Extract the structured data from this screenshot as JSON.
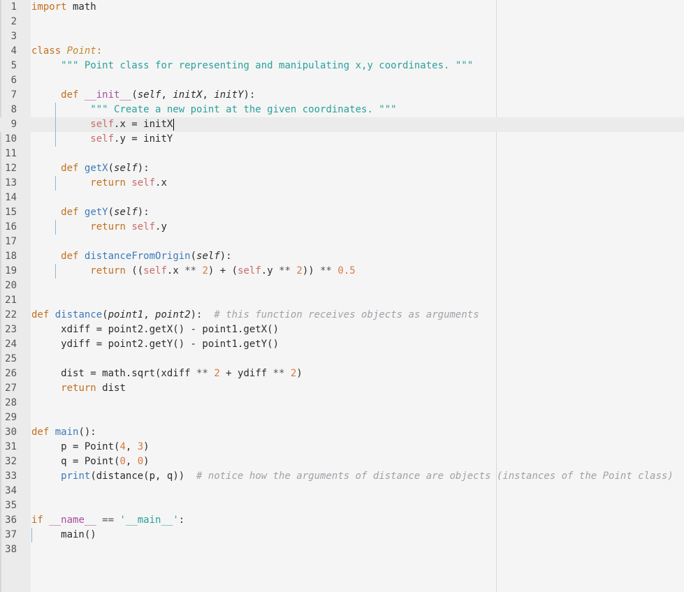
{
  "editor": {
    "language": "python",
    "current_line": 9,
    "lines": [
      {
        "n": "1",
        "t": [
          {
            "c": "kw",
            "s": "import"
          },
          {
            "c": "plain",
            "s": " math"
          }
        ]
      },
      {
        "n": "2",
        "t": []
      },
      {
        "n": "3",
        "t": []
      },
      {
        "n": "4",
        "t": [
          {
            "c": "kw",
            "s": "class"
          },
          {
            "c": "plain",
            "s": " "
          },
          {
            "c": "cls",
            "s": "Point"
          },
          {
            "c": "kw",
            "s": ":"
          }
        ]
      },
      {
        "n": "5",
        "t": [
          {
            "c": "plain",
            "s": "     "
          },
          {
            "c": "str",
            "s": "\"\"\" Point class for representing and manipulating x,y coordinates. \"\"\""
          }
        ]
      },
      {
        "n": "6",
        "t": []
      },
      {
        "n": "7",
        "t": [
          {
            "c": "plain",
            "s": "     "
          },
          {
            "c": "kw",
            "s": "def"
          },
          {
            "c": "plain",
            "s": " "
          },
          {
            "c": "under",
            "s": "__init__"
          },
          {
            "c": "plain",
            "s": "("
          },
          {
            "c": "param",
            "s": "self"
          },
          {
            "c": "plain",
            "s": ", "
          },
          {
            "c": "param",
            "s": "initX"
          },
          {
            "c": "plain",
            "s": ", "
          },
          {
            "c": "param",
            "s": "initY"
          },
          {
            "c": "plain",
            "s": "):"
          }
        ]
      },
      {
        "n": "8",
        "t": [
          {
            "c": "plain",
            "s": "          "
          },
          {
            "c": "str",
            "s": "\"\"\" Create a new point at the given coordinates. \"\"\""
          }
        ]
      },
      {
        "n": "9",
        "t": [
          {
            "c": "plain",
            "s": "          "
          },
          {
            "c": "self",
            "s": "self"
          },
          {
            "c": "plain",
            "s": ".x = initX"
          }
        ]
      },
      {
        "n": "10",
        "t": [
          {
            "c": "plain",
            "s": "          "
          },
          {
            "c": "self",
            "s": "self"
          },
          {
            "c": "plain",
            "s": ".y = initY"
          }
        ]
      },
      {
        "n": "11",
        "t": []
      },
      {
        "n": "12",
        "t": [
          {
            "c": "plain",
            "s": "     "
          },
          {
            "c": "kw",
            "s": "def"
          },
          {
            "c": "plain",
            "s": " "
          },
          {
            "c": "fn",
            "s": "getX"
          },
          {
            "c": "plain",
            "s": "("
          },
          {
            "c": "param",
            "s": "self"
          },
          {
            "c": "plain",
            "s": "):"
          }
        ]
      },
      {
        "n": "13",
        "t": [
          {
            "c": "plain",
            "s": "          "
          },
          {
            "c": "kw",
            "s": "return"
          },
          {
            "c": "plain",
            "s": " "
          },
          {
            "c": "self",
            "s": "self"
          },
          {
            "c": "plain",
            "s": ".x"
          }
        ]
      },
      {
        "n": "14",
        "t": []
      },
      {
        "n": "15",
        "t": [
          {
            "c": "plain",
            "s": "     "
          },
          {
            "c": "kw",
            "s": "def"
          },
          {
            "c": "plain",
            "s": " "
          },
          {
            "c": "fn",
            "s": "getY"
          },
          {
            "c": "plain",
            "s": "("
          },
          {
            "c": "param",
            "s": "self"
          },
          {
            "c": "plain",
            "s": "):"
          }
        ]
      },
      {
        "n": "16",
        "t": [
          {
            "c": "plain",
            "s": "          "
          },
          {
            "c": "kw",
            "s": "return"
          },
          {
            "c": "plain",
            "s": " "
          },
          {
            "c": "self",
            "s": "self"
          },
          {
            "c": "plain",
            "s": ".y"
          }
        ]
      },
      {
        "n": "17",
        "t": []
      },
      {
        "n": "18",
        "t": [
          {
            "c": "plain",
            "s": "     "
          },
          {
            "c": "kw",
            "s": "def"
          },
          {
            "c": "plain",
            "s": " "
          },
          {
            "c": "fn",
            "s": "distanceFromOrigin"
          },
          {
            "c": "plain",
            "s": "("
          },
          {
            "c": "param",
            "s": "self"
          },
          {
            "c": "plain",
            "s": "):"
          }
        ]
      },
      {
        "n": "19",
        "t": [
          {
            "c": "plain",
            "s": "          "
          },
          {
            "c": "kw",
            "s": "return"
          },
          {
            "c": "plain",
            "s": " (("
          },
          {
            "c": "self",
            "s": "self"
          },
          {
            "c": "plain",
            "s": ".x "
          },
          {
            "c": "op",
            "s": "**"
          },
          {
            "c": "plain",
            "s": " "
          },
          {
            "c": "num",
            "s": "2"
          },
          {
            "c": "plain",
            "s": ") + ("
          },
          {
            "c": "self",
            "s": "self"
          },
          {
            "c": "plain",
            "s": ".y "
          },
          {
            "c": "op",
            "s": "**"
          },
          {
            "c": "plain",
            "s": " "
          },
          {
            "c": "num",
            "s": "2"
          },
          {
            "c": "plain",
            "s": ")) "
          },
          {
            "c": "op",
            "s": "**"
          },
          {
            "c": "plain",
            "s": " "
          },
          {
            "c": "num",
            "s": "0.5"
          }
        ]
      },
      {
        "n": "20",
        "t": []
      },
      {
        "n": "21",
        "t": []
      },
      {
        "n": "22",
        "t": [
          {
            "c": "kw",
            "s": "def"
          },
          {
            "c": "plain",
            "s": " "
          },
          {
            "c": "fn",
            "s": "distance"
          },
          {
            "c": "plain",
            "s": "("
          },
          {
            "c": "param",
            "s": "point1"
          },
          {
            "c": "plain",
            "s": ", "
          },
          {
            "c": "param",
            "s": "point2"
          },
          {
            "c": "plain",
            "s": "):  "
          },
          {
            "c": "cmt",
            "s": "# this function receives objects as arguments"
          }
        ]
      },
      {
        "n": "23",
        "t": [
          {
            "c": "plain",
            "s": "     xdiff = point2.getX() - point1.getX()"
          }
        ]
      },
      {
        "n": "24",
        "t": [
          {
            "c": "plain",
            "s": "     ydiff = point2.getY() - point1.getY()"
          }
        ]
      },
      {
        "n": "25",
        "t": []
      },
      {
        "n": "26",
        "t": [
          {
            "c": "plain",
            "s": "     dist = math.sqrt(xdiff "
          },
          {
            "c": "op",
            "s": "**"
          },
          {
            "c": "plain",
            "s": " "
          },
          {
            "c": "num",
            "s": "2"
          },
          {
            "c": "plain",
            "s": " + ydiff "
          },
          {
            "c": "op",
            "s": "**"
          },
          {
            "c": "plain",
            "s": " "
          },
          {
            "c": "num",
            "s": "2"
          },
          {
            "c": "plain",
            "s": ")"
          }
        ]
      },
      {
        "n": "27",
        "t": [
          {
            "c": "plain",
            "s": "     "
          },
          {
            "c": "kw",
            "s": "return"
          },
          {
            "c": "plain",
            "s": " dist"
          }
        ]
      },
      {
        "n": "28",
        "t": []
      },
      {
        "n": "29",
        "t": []
      },
      {
        "n": "30",
        "t": [
          {
            "c": "kw",
            "s": "def"
          },
          {
            "c": "plain",
            "s": " "
          },
          {
            "c": "fn",
            "s": "main"
          },
          {
            "c": "plain",
            "s": "():"
          }
        ]
      },
      {
        "n": "31",
        "t": [
          {
            "c": "plain",
            "s": "     p = Point("
          },
          {
            "c": "num",
            "s": "4"
          },
          {
            "c": "plain",
            "s": ", "
          },
          {
            "c": "num",
            "s": "3"
          },
          {
            "c": "plain",
            "s": ")"
          }
        ]
      },
      {
        "n": "32",
        "t": [
          {
            "c": "plain",
            "s": "     q = Point("
          },
          {
            "c": "num",
            "s": "0"
          },
          {
            "c": "plain",
            "s": ", "
          },
          {
            "c": "num",
            "s": "0"
          },
          {
            "c": "plain",
            "s": ")"
          }
        ]
      },
      {
        "n": "33",
        "t": [
          {
            "c": "plain",
            "s": "     "
          },
          {
            "c": "fn",
            "s": "print"
          },
          {
            "c": "plain",
            "s": "(distance(p, q))  "
          },
          {
            "c": "cmt",
            "s": "# notice how the arguments of distance are objects (instances of the Point class)"
          }
        ]
      },
      {
        "n": "34",
        "t": []
      },
      {
        "n": "35",
        "t": []
      },
      {
        "n": "36",
        "t": [
          {
            "c": "kw",
            "s": "if"
          },
          {
            "c": "plain",
            "s": " "
          },
          {
            "c": "under",
            "s": "__name__"
          },
          {
            "c": "plain",
            "s": " "
          },
          {
            "c": "op",
            "s": "=="
          },
          {
            "c": "plain",
            "s": " "
          },
          {
            "c": "str",
            "s": "'__main__'"
          },
          {
            "c": "plain",
            "s": ":"
          }
        ]
      },
      {
        "n": "37",
        "t": [
          {
            "c": "plain",
            "s": "     main()"
          }
        ]
      },
      {
        "n": "38",
        "t": []
      }
    ]
  }
}
